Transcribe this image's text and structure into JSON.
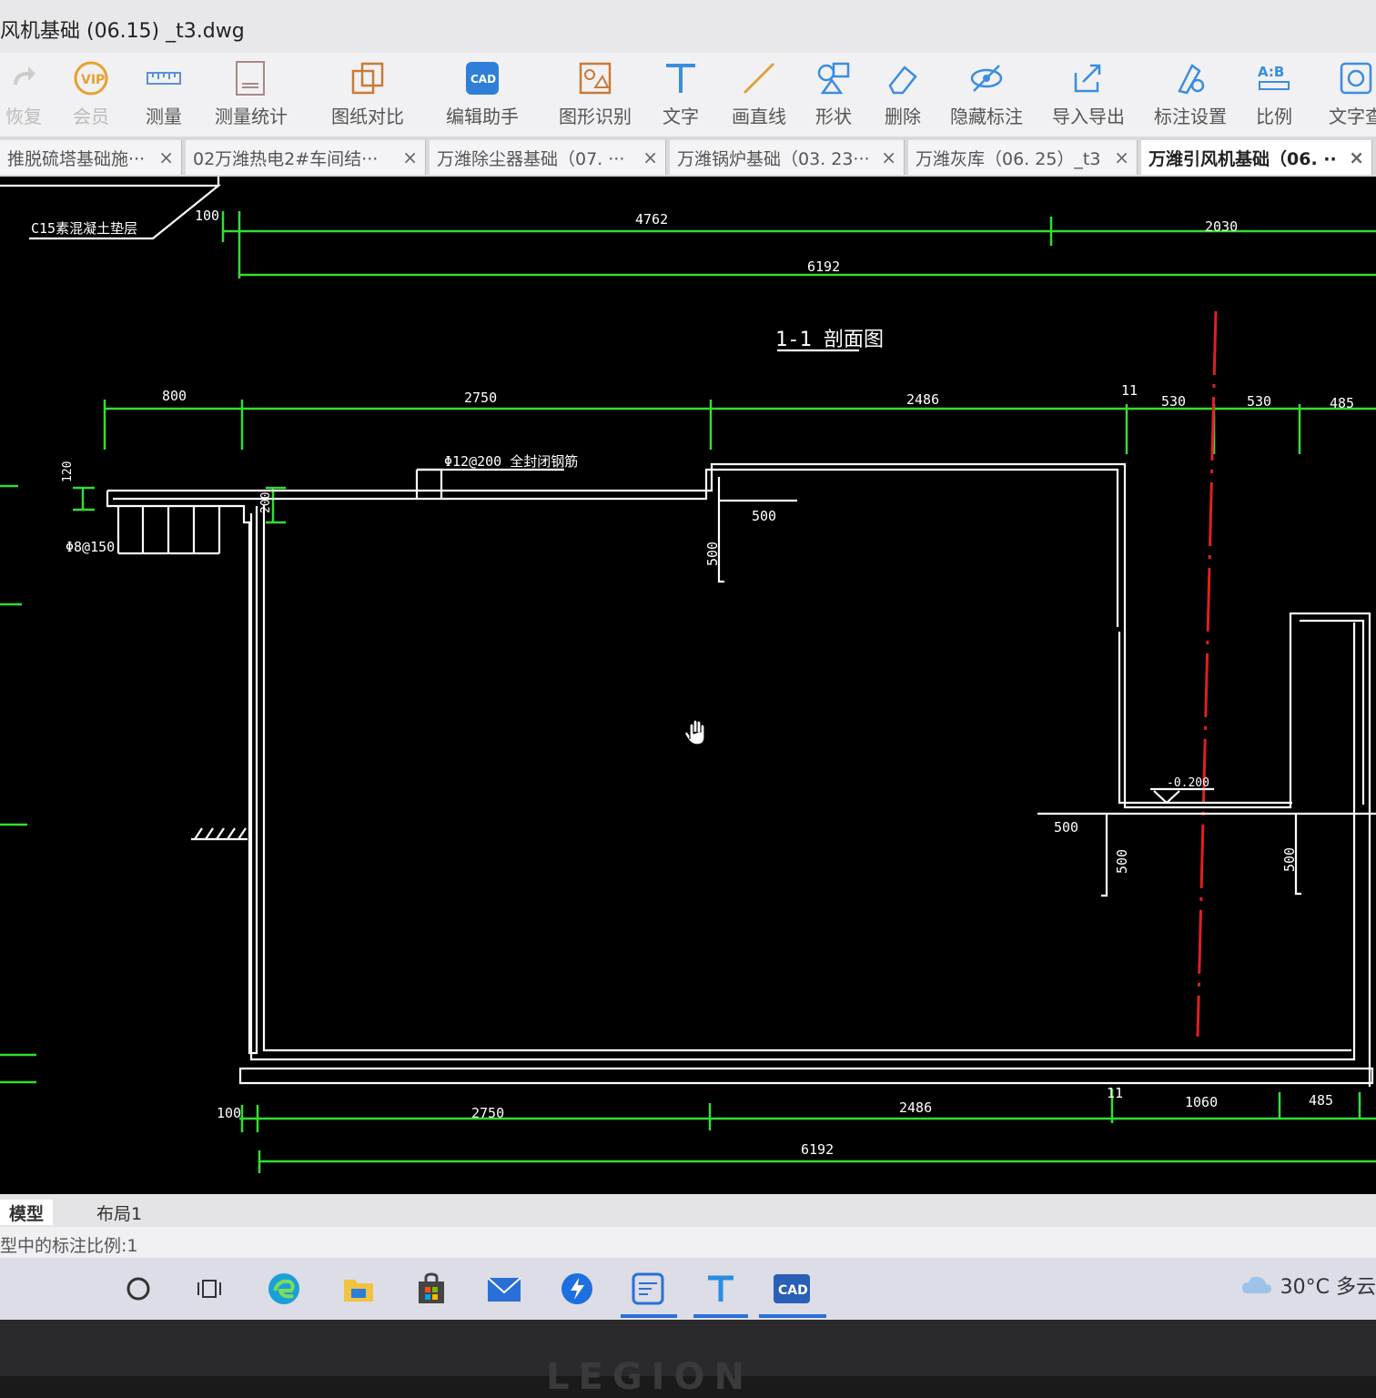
{
  "window": {
    "title": "风机基础 (06.15) _t3.dwg"
  },
  "toolbar": {
    "items": [
      {
        "label": "恢复",
        "icon": "redo-icon"
      },
      {
        "label": "会员",
        "icon": "vip-icon"
      },
      {
        "label": "测量",
        "icon": "ruler-icon"
      },
      {
        "label": "测量统计",
        "icon": "measure-stats-icon"
      },
      {
        "label": "图纸对比",
        "icon": "compare-icon"
      },
      {
        "label": "编辑助手",
        "icon": "cad-edit-icon"
      },
      {
        "label": "图形识别",
        "icon": "shape-recognize-icon"
      },
      {
        "label": "文字",
        "icon": "text-icon"
      },
      {
        "label": "画直线",
        "icon": "line-icon"
      },
      {
        "label": "形状",
        "icon": "shape-icon"
      },
      {
        "label": "删除",
        "icon": "eraser-icon"
      },
      {
        "label": "隐藏标注",
        "icon": "hide-icon"
      },
      {
        "label": "导入导出",
        "icon": "import-export-icon"
      },
      {
        "label": "标注设置",
        "icon": "annotation-settings-icon"
      },
      {
        "label": "比例",
        "icon": "ratio-icon"
      },
      {
        "label": "文字查",
        "icon": "text-search-icon"
      }
    ]
  },
  "tabs": [
    {
      "label": "推脱硫塔基础施···",
      "active": false
    },
    {
      "label": "02万潍热电2#车间结···",
      "active": false
    },
    {
      "label": "万潍除尘器基础（07. ···",
      "active": false
    },
    {
      "label": "万潍锅炉基础（03. 23···",
      "active": false
    },
    {
      "label": "万潍灰库（06. 25）_t3",
      "active": false
    },
    {
      "label": "万潍引风机基础（06. ··",
      "active": true
    }
  ],
  "drawing": {
    "section_title": "1-1  剖面图",
    "labels": {
      "cushion": "C15素混凝土垫层",
      "rebar_top": "Φ12@200 全封闭钢筋",
      "rebar_left": "Φ8@150",
      "elevation": "-0.200"
    },
    "dims": {
      "top_100": "100",
      "top_4762": "4762",
      "top_2030": "2030",
      "top_6192": "6192",
      "mid_800": "800",
      "mid_2750": "2750",
      "mid_2486": "2486",
      "mid_11": "11",
      "mid_530a": "530",
      "mid_530b": "530",
      "mid_485": "485",
      "left_120": "120",
      "left_200": "200",
      "inner_500a": "500",
      "inner_500b": "500",
      "right_500a": "500",
      "right_500b": "500",
      "right_500c": "500",
      "bot_100": "100",
      "bot_2750": "2750",
      "bot_2486": "2486",
      "bot_11": "11",
      "bot_1060": "1060",
      "bot_485": "485",
      "bot_6192": "6192"
    }
  },
  "layout_tabs": [
    {
      "label": "模型",
      "active": true
    },
    {
      "label": "布局1",
      "active": false
    }
  ],
  "status": {
    "text": "型中的标注比例:1"
  },
  "taskbar": {
    "icons": [
      "search-icon",
      "task-view-icon",
      "edge-icon",
      "file-explorer-icon",
      "store-icon",
      "mail-icon",
      "thunder-icon",
      "cad-viewer-icon",
      "text-app-icon",
      "cad-app-icon"
    ],
    "weather": "30°C 多云"
  },
  "bezel": {
    "brand": "LEGION"
  },
  "colors": {
    "dim": "#33dd33",
    "drawing": "#ffffff",
    "axis": "#e02020",
    "accent": "#2a6fd8"
  }
}
